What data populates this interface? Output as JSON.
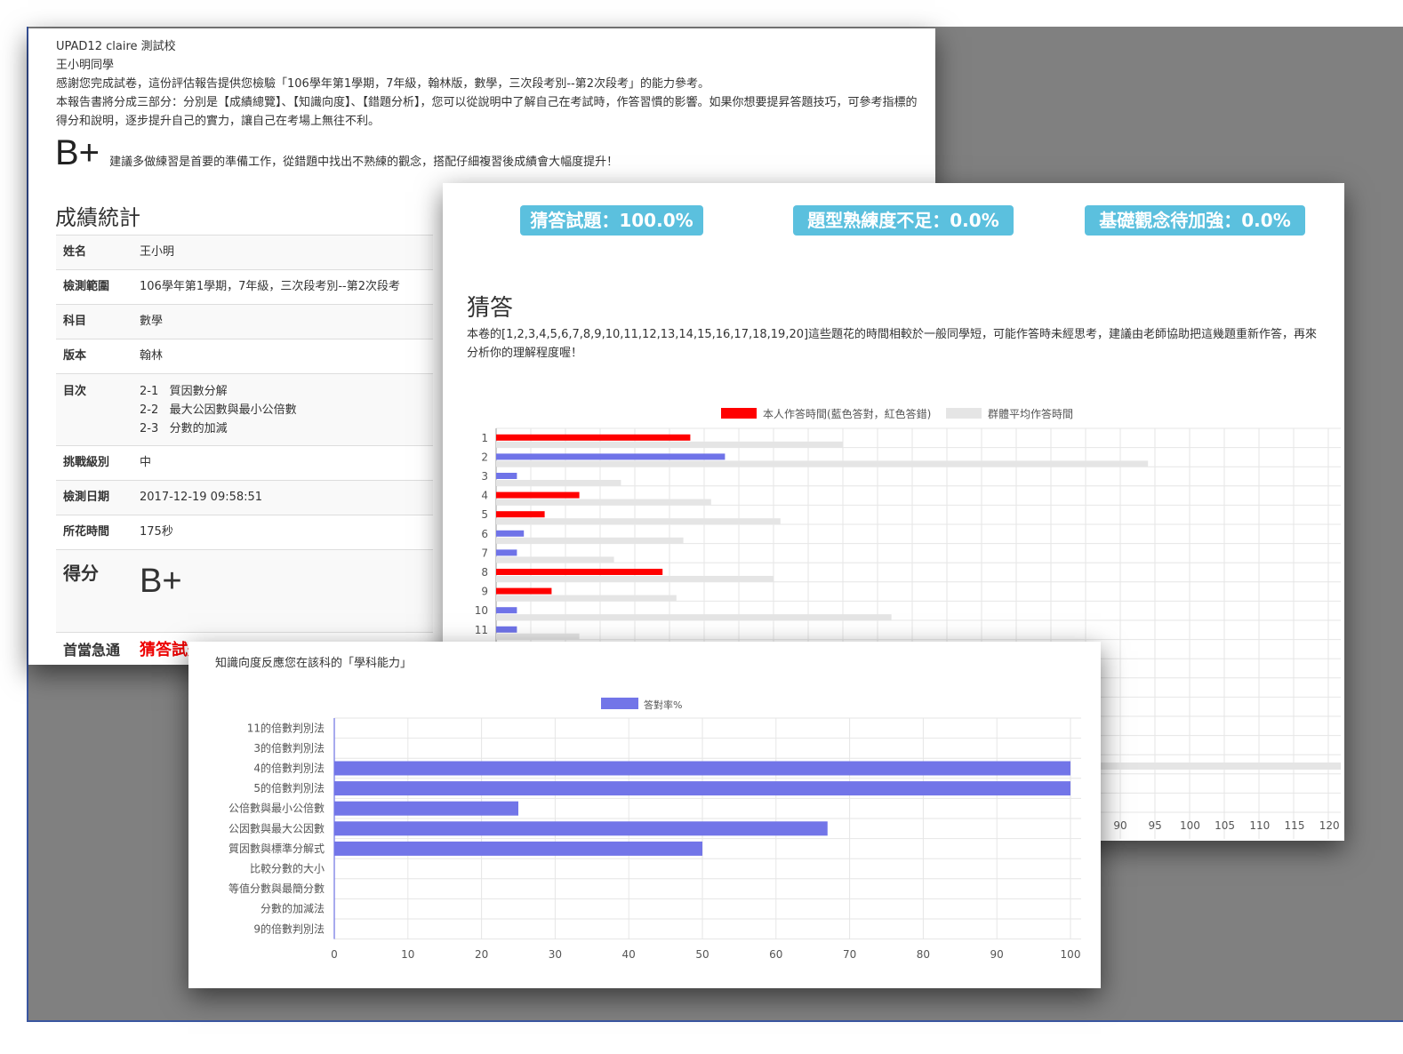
{
  "report": {
    "school": "UPAD12 claire 測試校",
    "student": "王小明同學",
    "intro": "感謝您完成試卷，這份評估報告提供您檢驗「106學年第1學期，7年級，翰林版，數學，三次段考別--第2次段考」的能力參考。",
    "intro2": "本報告書將分成三部分：分別是【成績總覽】、【知識向度】、【錯題分析】，您可以從說明中了解自己在考試時，作答習慣的影響。如果你想要提昇答題技巧，可參考指標的得分和說明，逐步提升自己的實力，讓自己在考場上無往不利。",
    "grade": "B+",
    "grade_note": "建議多做練習是首要的準備工作，從錯題中找出不熟練的觀念，搭配仔細複習後成績會大幅度提升！",
    "section_title": "成績統計",
    "stats": {
      "name_label": "姓名",
      "name": "王小明",
      "range_label": "檢測範圍",
      "range": "106學年第1學期，7年級，三次段考別--第2次段考",
      "subject_label": "科目",
      "subject": "數學",
      "edition_label": "版本",
      "edition": "翰林",
      "toc_label": "目次",
      "toc": [
        {
          "num": "2-1",
          "title": "質因數分解"
        },
        {
          "num": "2-2",
          "title": "最大公因數與最小公倍數"
        },
        {
          "num": "2-3",
          "title": "分數的加減"
        }
      ],
      "level_label": "挑戰級別",
      "level": "中",
      "date_label": "檢測日期",
      "date": "2017-12-19 09:58:51",
      "time_label": "所花時間",
      "time": "175秒",
      "score_label": "得分",
      "score": "B+",
      "urgent_label": "首當急通",
      "urgent": "猜答試題"
    }
  },
  "badges": {
    "guess": "猜答試題：100.0%",
    "unfamiliar": "題型熟練度不足：0.0%",
    "basic": "基礎觀念待加強：0.0%",
    "color": "#5bc0de"
  },
  "guess": {
    "title": "猜答",
    "desc": "本卷的[1,2,3,4,5,6,7,8,9,10,11,12,13,14,15,16,17,18,19,20]這些題花的時間相較於一般同學短，可能作答時未經思考，建議由老師協助把這幾題重新作答，再來分析你的理解程度喔！"
  },
  "knowledge": {
    "title": "知識向度反應您在該科的「學科能力」"
  },
  "chart_data": [
    {
      "type": "bar",
      "orientation": "horizontal",
      "categories": [
        "1",
        "2",
        "3",
        "4",
        "5",
        "6",
        "7",
        "8",
        "9",
        "10",
        "11"
      ],
      "series": [
        {
          "name": "本人作答時間(藍色答對，紅色答錯)",
          "values": [
            28,
            33,
            3,
            12,
            7,
            4,
            3,
            24,
            8,
            3,
            3
          ],
          "bar_colors": [
            "#ff0000",
            "#6f73e8",
            "#6f73e8",
            "#ff0000",
            "#ff0000",
            "#6f73e8",
            "#6f73e8",
            "#ff0000",
            "#ff0000",
            "#6f73e8",
            "#6f73e8"
          ]
        },
        {
          "name": "群體平均作答時間",
          "values": [
            50,
            94,
            18,
            31,
            41,
            27,
            17,
            40,
            26,
            57,
            12
          ]
        }
      ],
      "x_ticks_visible": [
        "90",
        "95",
        "100",
        "105",
        "110",
        "115",
        "120"
      ],
      "xlim": [
        0,
        120
      ],
      "colors": {
        "correct": "#6f73e8",
        "wrong": "#ff0000",
        "average": "#e5e5e5"
      },
      "grid": true,
      "legend": "top"
    },
    {
      "type": "bar",
      "orientation": "horizontal",
      "categories": [
        "11的倍數判別法",
        "3的倍數判別法",
        "4的倍數判別法",
        "5的倍數判別法",
        "公倍數與最小公倍數",
        "公因數與最大公因數",
        "質因數與標準分解式",
        "比較分數的大小",
        "等值分數與最簡分數",
        "分數的加減法",
        "9的倍數判別法"
      ],
      "series": [
        {
          "name": "答對率%",
          "values": [
            0,
            0,
            100,
            100,
            25,
            67,
            50,
            0,
            0,
            0,
            0
          ],
          "color": "#7275e8"
        }
      ],
      "x_ticks": [
        "0",
        "10",
        "20",
        "30",
        "40",
        "50",
        "60",
        "70",
        "80",
        "90",
        "100"
      ],
      "xlim": [
        0,
        100
      ],
      "grid": true,
      "legend": "top"
    }
  ]
}
